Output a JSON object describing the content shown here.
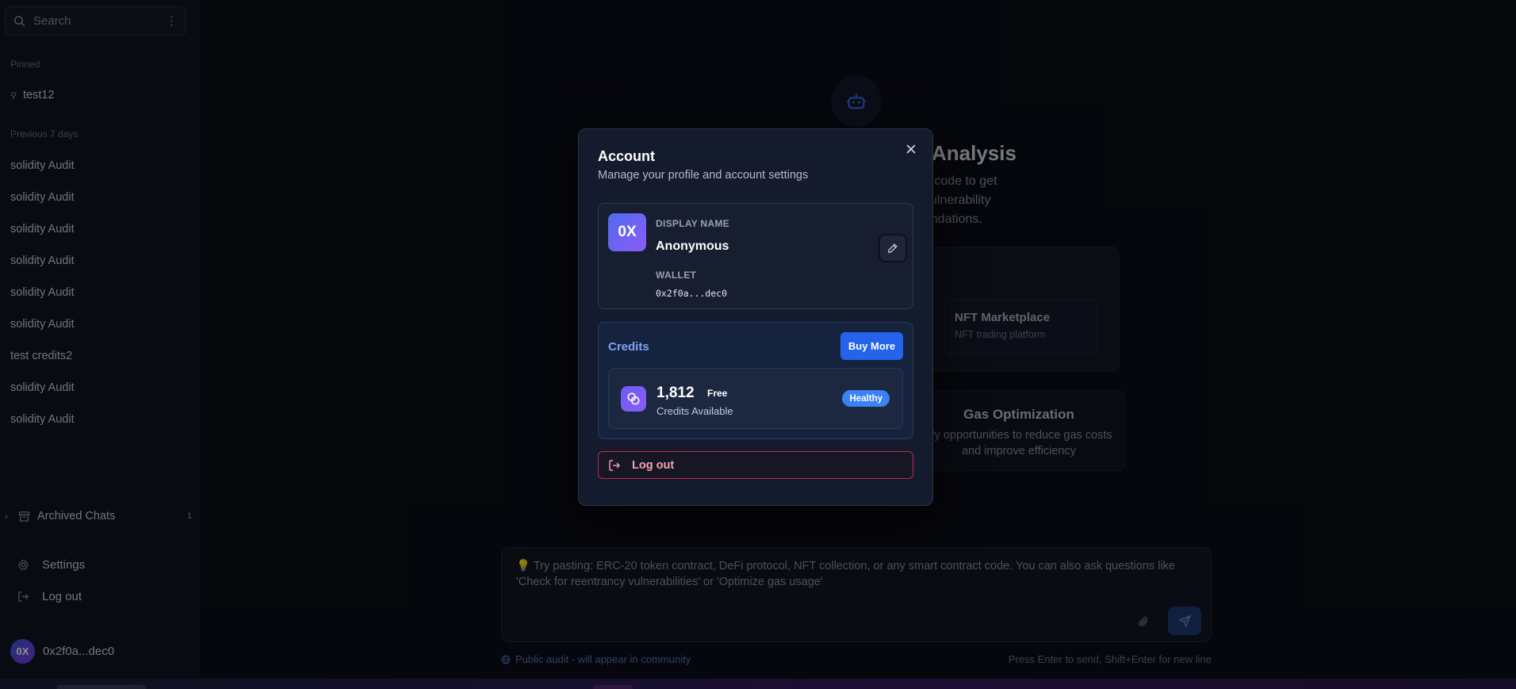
{
  "sidebar": {
    "search_placeholder": "Search",
    "pinned_label": "Pinned",
    "pinned_items": [
      {
        "label": "test12"
      }
    ],
    "recent_label": "Previous 7 days",
    "chats": [
      {
        "label": "solidity Audit"
      },
      {
        "label": "solidity Audit"
      },
      {
        "label": "solidity Audit"
      },
      {
        "label": "solidity Audit"
      },
      {
        "label": "solidity Audit"
      },
      {
        "label": "solidity Audit"
      },
      {
        "label": "test credits2"
      },
      {
        "label": "solidity Audit"
      },
      {
        "label": "solidity Audit"
      }
    ],
    "archived_label": "Archived Chats",
    "archived_count": "1",
    "settings_label": "Settings",
    "logout_label": "Log out",
    "user": {
      "avatar_initials": "0X",
      "wallet": "0x2f0a...dec0"
    }
  },
  "main": {
    "hero_title": "Analysis",
    "hero_text": "e code to get vulnerability endations.",
    "cards": [
      {
        "title": "NFT Marketplace",
        "subtitle": "NFT trading platform"
      },
      {
        "title": "Gas Optimization",
        "subtitle": "tify opportunities to reduce gas costs and improve efficiency"
      }
    ],
    "composer_placeholder": "💡 Try pasting: ERC-20 token contract, DeFi protocol, NFT collection, or any smart contract code. You can also ask questions like 'Check for reentrancy vulnerabilities' or 'Optimize gas usage'",
    "public_note": "Public audit - will appear in community",
    "send_hint": "Press Enter to send, Shift+Enter for new line"
  },
  "modal": {
    "title": "Account",
    "subtitle": "Manage your profile and account settings",
    "profile": {
      "avatar_initials": "0X",
      "display_name_label": "DISPLAY NAME",
      "display_name": "Anonymous",
      "wallet_label": "WALLET",
      "wallet": "0x2f0a...dec0"
    },
    "credits": {
      "title": "Credits",
      "buy_label": "Buy More",
      "value": "1,812",
      "plan": "Free",
      "label": "Credits Available",
      "status": "Healthy"
    },
    "logout_label": "Log out"
  },
  "colors": {
    "accent": "#2563eb",
    "danger": "#c3264e",
    "avatar_gradient_start": "#4f6bf0",
    "avatar_gradient_end": "#8b5cf6"
  }
}
